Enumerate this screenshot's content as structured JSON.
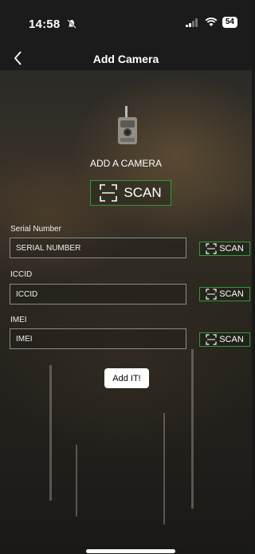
{
  "status_bar": {
    "time": "14:58",
    "battery": "54"
  },
  "nav": {
    "title": "Add Camera"
  },
  "main": {
    "heading": "ADD A CAMERA",
    "scan_label": "SCAN",
    "fields": [
      {
        "label": "Serial Number",
        "placeholder": "SERIAL NUMBER",
        "scan_label": "SCAN"
      },
      {
        "label": "ICCID",
        "placeholder": "ICCID",
        "scan_label": "SCAN"
      },
      {
        "label": "IMEI",
        "placeholder": "IMEI",
        "scan_label": "SCAN"
      }
    ],
    "add_button": "Add IT!"
  },
  "colors": {
    "accent": "#2e9a3a",
    "background": "#1b1b1b"
  }
}
